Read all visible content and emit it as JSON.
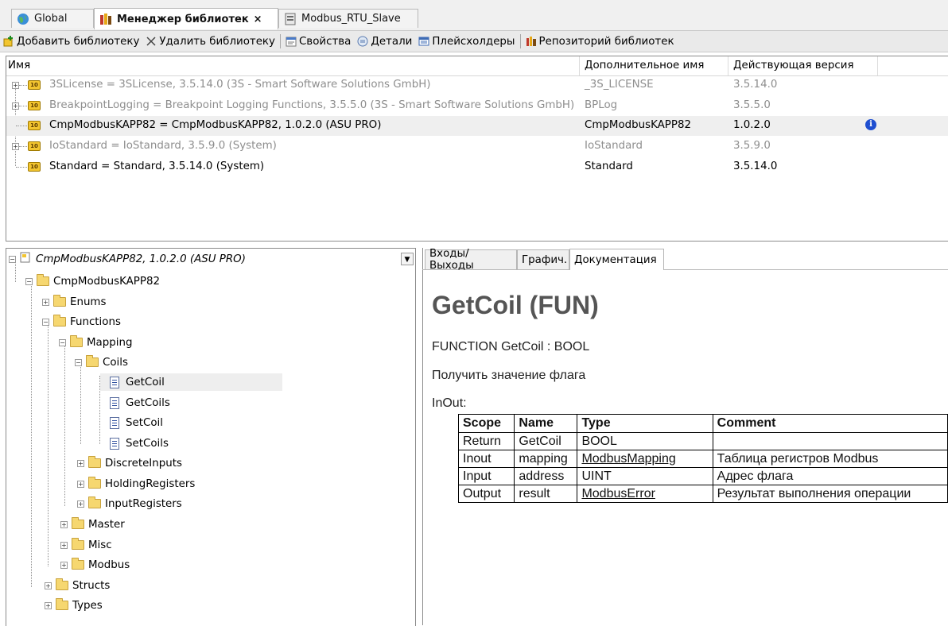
{
  "tabs": [
    {
      "label": "Global",
      "icon": "globe-icon"
    },
    {
      "label": "Менеджер библиотек",
      "icon": "library-manager-icon"
    },
    {
      "label": "Modbus_RTU_Slave",
      "icon": "device-icon"
    }
  ],
  "toolbar": {
    "add_library": "Добавить библиотеку",
    "remove_library": "Удалить библиотеку",
    "properties": "Свойства",
    "details": "Детали",
    "placeholders": "Плейсхолдеры",
    "repository": "Репозиторий библиотек"
  },
  "library_list": {
    "headers": {
      "name": "Имя",
      "alias": "Дополнительное имя",
      "version": "Действующая версия"
    },
    "rows": [
      {
        "name": "3SLicense = 3SLicense, 3.5.14.0 (3S - Smart Software Solutions GmbH)",
        "alias": "_3S_LICENSE",
        "version": "3.5.14.0"
      },
      {
        "name": "BreakpointLogging = Breakpoint Logging Functions, 3.5.5.0 (3S - Smart Software Solutions GmbH)",
        "alias": "BPLog",
        "version": "3.5.5.0"
      },
      {
        "name": "CmpModbusKAPP82 = CmpModbusKAPP82, 1.0.2.0 (ASU PRO)",
        "alias": "CmpModbusKAPP82",
        "version": "1.0.2.0"
      },
      {
        "name": "IoStandard = IoStandard, 3.5.9.0 (System)",
        "alias": "IoStandard",
        "version": "3.5.9.0"
      },
      {
        "name": "Standard = Standard, 3.5.14.0 (System)",
        "alias": "Standard",
        "version": "3.5.14.0"
      }
    ]
  },
  "tree": {
    "root": "CmpModbusKAPP82, 1.0.2.0 (ASU PRO)",
    "nodes": {
      "module": "CmpModbusKAPP82",
      "enums": "Enums",
      "functions": "Functions",
      "mapping": "Mapping",
      "coils": "Coils",
      "getcoil": "GetCoil",
      "getcoils": "GetCoils",
      "setcoil": "SetCoil",
      "setcoils": "SetCoils",
      "discrete": "DiscreteInputs",
      "holding": "HoldingRegisters",
      "input": "InputRegisters",
      "master": "Master",
      "misc": "Misc",
      "modbus": "Modbus",
      "structs": "Structs",
      "types": "Types"
    }
  },
  "doc_tabs": [
    "Входы/Выходы",
    "Графич.",
    "Документация"
  ],
  "doc": {
    "title": "GetCoil (FUN)",
    "signature": "FUNCTION GetCoil : BOOL",
    "description": "Получить значение флага",
    "inout_label": "InOut:",
    "table_headers": [
      "Scope",
      "Name",
      "Type",
      "Comment"
    ],
    "table_rows": [
      [
        "Return",
        "GetCoil",
        "BOOL",
        ""
      ],
      [
        "Inout",
        "mapping",
        "ModbusMapping",
        "Таблица регистров Modbus"
      ],
      [
        "Input",
        "address",
        "UINT",
        "Адрес флага"
      ],
      [
        "Output",
        "result",
        "ModbusError",
        "Результат выполнения операции"
      ]
    ]
  }
}
